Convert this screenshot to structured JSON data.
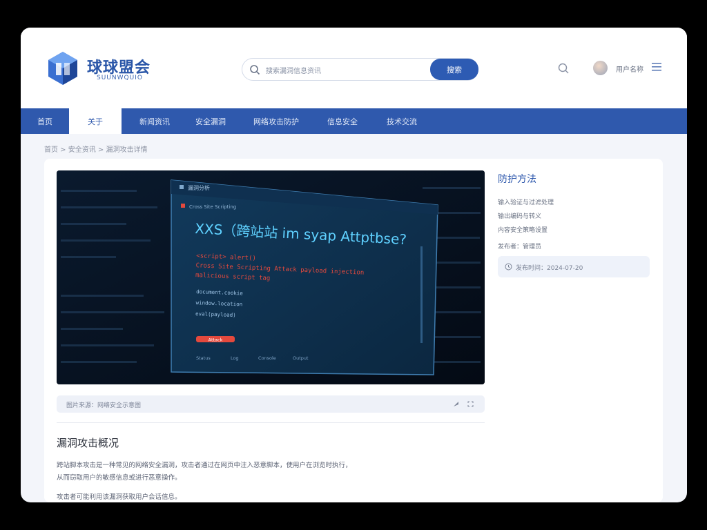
{
  "brand": {
    "name": "球球盟会",
    "subtitle": "SUUNWQUIO"
  },
  "search": {
    "placeholder": "搜索漏洞信息资讯",
    "button_label": "搜索"
  },
  "user": {
    "name": "用户名称"
  },
  "nav": {
    "items": [
      {
        "label": "首页",
        "active": false
      },
      {
        "label": "关于",
        "active": true
      },
      {
        "label": "新闻资讯",
        "active": false
      },
      {
        "label": "安全漏洞",
        "active": false
      },
      {
        "label": "网络攻击防护",
        "active": false
      },
      {
        "label": "信息安全",
        "active": false
      },
      {
        "label": "技术交流",
        "active": false
      }
    ]
  },
  "breadcrumb": "首页 > 安全资讯 > 漏洞攻击详情",
  "hero": {
    "window_title": "漏洞分析",
    "window_subtitle": "Cross Site Scripting",
    "headline": "XXS（跨站站 im syap Attptbse?",
    "red_lines": [
      "<script> alert()",
      "Cross Site Scripting Attack payload injection",
      "malicious script tag"
    ],
    "white_lines": [
      "document.cookie",
      "window.location",
      "eval(payload)"
    ],
    "action_label": "Attack",
    "footer_items": [
      "Status",
      "Log",
      "Console",
      "Output"
    ]
  },
  "caption": {
    "text": "图片来源：网络安全示意图"
  },
  "article": {
    "title": "漏洞攻击概况",
    "paragraphs": [
      "跨站脚本攻击是一种常见的网络安全漏洞，攻击者通过在网页中注入恶意脚本，使用户在浏览时执行，",
      "从而窃取用户的敏感信息或进行恶意操作。",
      "攻击者可能利用该漏洞获取用户会话信息。"
    ]
  },
  "sidebar": {
    "title": "防护方法",
    "items": [
      "输入验证与过滤处理",
      "输出编码与转义",
      "内容安全策略设置"
    ],
    "author": "发布者：管理员",
    "date_label": "发布时间：2024-07-20"
  },
  "colors": {
    "accent": "#2f59ad",
    "button": "#2d5bb3",
    "hero_cyan": "#5fd1ff",
    "hero_red": "#e4493d"
  }
}
